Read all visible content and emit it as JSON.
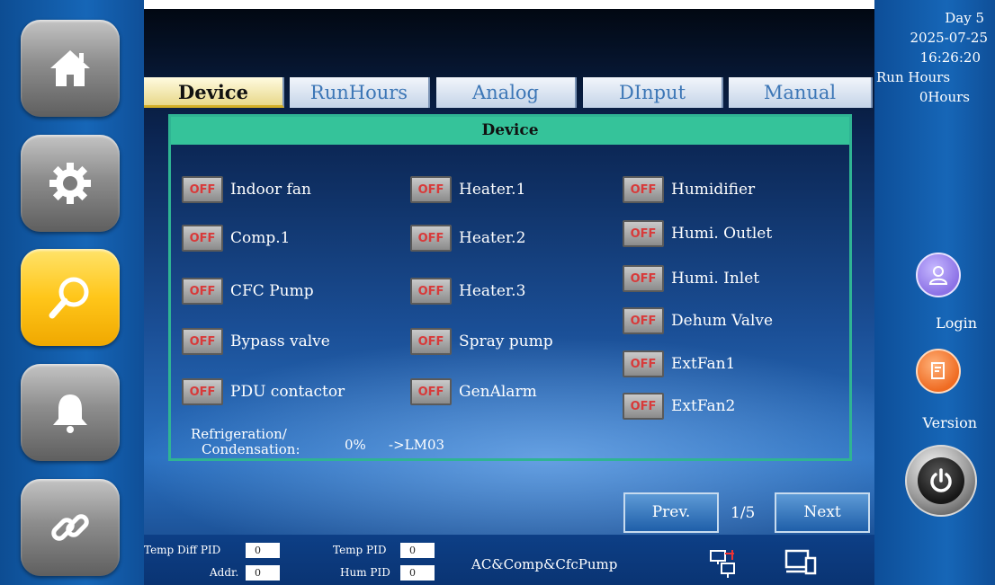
{
  "tabs": [
    "Device",
    "RunHours",
    "Analog",
    "DInput",
    "Manual"
  ],
  "panel": {
    "title": "Device"
  },
  "off_label": "OFF",
  "devices": {
    "col1": [
      "Indoor fan",
      "Comp.1",
      "CFC Pump",
      "Bypass valve",
      "PDU contactor"
    ],
    "col2": [
      "Heater.1",
      "Heater.2",
      "Heater.3",
      "Spray pump",
      "GenAlarm"
    ],
    "col3": [
      "Humidifier",
      "Humi. Outlet",
      "Humi. Inlet",
      "Dehum Valve",
      "ExtFan1",
      "ExtFan2"
    ]
  },
  "refrigeration": {
    "label_line1": "Refrigeration/",
    "label_line2": "Condensation:",
    "value": "0%",
    "target": "->LM03"
  },
  "pager": {
    "prev": "Prev.",
    "indicator": "1/5",
    "next": "Next"
  },
  "bottom": {
    "temp_diff_pid_label": "Temp Diff PID",
    "temp_diff_pid_value": "0",
    "addr_label": "Addr.",
    "addr_value": "0",
    "temp_pid_label": "Temp PID",
    "temp_pid_value": "0",
    "hum_pid_label": "Hum PID",
    "hum_pid_value": "0",
    "mode_text": "AC&Comp&CfcPump"
  },
  "status": {
    "day": "Day  5",
    "date": "2025-07-25",
    "time": "16:26:20",
    "run_hours_label": "Run Hours",
    "run_hours_value": "0Hours"
  },
  "right_buttons": {
    "login": "Login",
    "version": "Version"
  },
  "nav_icons": [
    "home-icon",
    "gear-icon",
    "search-icon",
    "bell-icon",
    "link-icon"
  ],
  "colors": {
    "panel_border": "#2fb493",
    "panel_header": "#35c39a",
    "off_text": "#d83a3a",
    "active_nav": "#ffc61a"
  }
}
